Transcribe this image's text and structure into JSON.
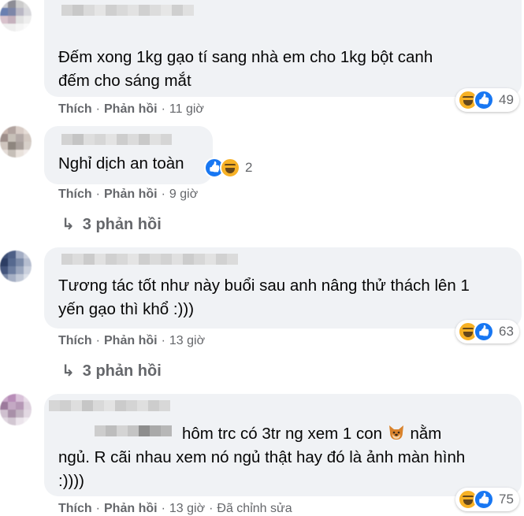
{
  "labels": {
    "like": "Thích",
    "reply": "Phản hồi",
    "separator": "·"
  },
  "colors": {
    "bubble": "#f0f2f5",
    "meta_text": "#65676b",
    "like_blue": "#1877f2",
    "haha_yellow": "#f7b125"
  },
  "comments": [
    {
      "lines": [
        "Đếm xong 1kg gạo tí sang nhà em cho 1kg bột canh",
        "đếm cho sáng mắt"
      ],
      "time": "11 giờ",
      "reactions": [
        "haha",
        "like"
      ],
      "reaction_count": "49"
    },
    {
      "lines": [
        "Nghỉ dịch an toàn"
      ],
      "time": "9 giờ",
      "reactions": [
        "like",
        "haha"
      ],
      "reaction_count": "2",
      "replies": "3 phản hồi"
    },
    {
      "lines": [
        "Tương tác tốt như này buổi sau anh nâng thử thách lên 1",
        "yến gạo thì khổ :)))"
      ],
      "time": "13 giờ",
      "reactions": [
        "haha",
        "like"
      ],
      "reaction_count": "63",
      "replies": "3 phản hồi"
    },
    {
      "lines": [
        "hôm trc có 3tr ng xem 1 con",
        "nằm",
        "ngủ. R cãi nhau xem nó ngủ thật hay đó là ảnh màn hình",
        ":))))"
      ],
      "time": "13 giờ",
      "edited": "Đã chỉnh sửa",
      "reactions": [
        "haha",
        "like"
      ],
      "reaction_count": "75",
      "inline_emoji": "dog-face-icon"
    }
  ]
}
